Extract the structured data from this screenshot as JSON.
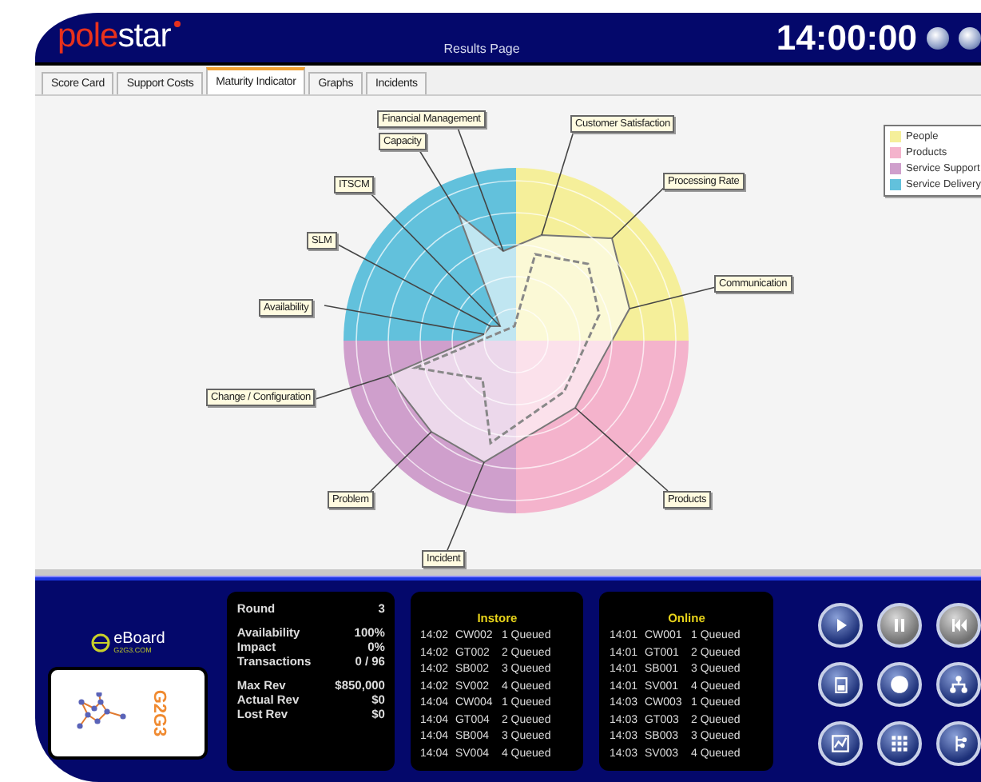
{
  "header": {
    "logo_left": "pole",
    "logo_right": "star",
    "title": "Results Page",
    "clock": "14:00:00"
  },
  "tabs": [
    {
      "label": "Score Card",
      "selected": false
    },
    {
      "label": "Support Costs",
      "selected": false
    },
    {
      "label": "Maturity Indicator",
      "selected": true
    },
    {
      "label": "Graphs",
      "selected": false
    },
    {
      "label": "Incidents",
      "selected": false
    }
  ],
  "radar": {
    "callouts": [
      "Financial Management",
      "Customer Satisfaction",
      "Capacity",
      "ITSCM",
      "Processing Rate",
      "SLM",
      "Communication",
      "Availability",
      "Change / Configuration",
      "Problem",
      "Products",
      "Incident"
    ],
    "legend": [
      {
        "label": "People",
        "color": "#f5ef9a"
      },
      {
        "label": "Products",
        "color": "#f4b3cc"
      },
      {
        "label": "Service Support",
        "color": "#cf9fcc"
      },
      {
        "label": "Service Delivery",
        "color": "#62c1dc"
      }
    ]
  },
  "brand": {
    "name": "eBoard",
    "site": "G2G3.COM",
    "badge": "G2G3"
  },
  "stats": [
    [
      {
        "label": "Round",
        "value": "3"
      }
    ],
    [
      {
        "label": "Availability",
        "value": "100%"
      },
      {
        "label": "Impact",
        "value": "0%"
      },
      {
        "label": "Transactions",
        "value": "0 / 96"
      }
    ],
    [
      {
        "label": "Max Rev",
        "value": "$850,000"
      },
      {
        "label": "Actual Rev",
        "value": "$0"
      },
      {
        "label": "Lost Rev",
        "value": "$0"
      }
    ]
  ],
  "queues": [
    {
      "title": "Instore",
      "rows": [
        [
          "14:02",
          "CW002",
          "1 Queued"
        ],
        [
          "14:02",
          "GT002",
          "2 Queued"
        ],
        [
          "14:02",
          "SB002",
          "3 Queued"
        ],
        [
          "14:02",
          "SV002",
          "4 Queued"
        ],
        [
          "14:04",
          "CW004",
          "1 Queued"
        ],
        [
          "14:04",
          "GT004",
          "2 Queued"
        ],
        [
          "14:04",
          "SB004",
          "3 Queued"
        ],
        [
          "14:04",
          "SV004",
          "4 Queued"
        ]
      ]
    },
    {
      "title": "Online",
      "rows": [
        [
          "14:01",
          "CW001",
          "1 Queued"
        ],
        [
          "14:01",
          "GT001",
          "2 Queued"
        ],
        [
          "14:01",
          "SB001",
          "3 Queued"
        ],
        [
          "14:01",
          "SV001",
          "4 Queued"
        ],
        [
          "14:03",
          "CW003",
          "1 Queued"
        ],
        [
          "14:03",
          "GT003",
          "2 Queued"
        ],
        [
          "14:03",
          "SB003",
          "3 Queued"
        ],
        [
          "14:03",
          "SV003",
          "4 Queued"
        ]
      ]
    }
  ],
  "controls": [
    {
      "kind": "play",
      "disabled": false
    },
    {
      "kind": "pause",
      "disabled": true
    },
    {
      "kind": "rewind",
      "disabled": true
    },
    {
      "kind": "save",
      "disabled": false
    },
    {
      "kind": "stop",
      "disabled": false
    },
    {
      "kind": "network",
      "disabled": false
    },
    {
      "kind": "chart",
      "disabled": false
    },
    {
      "kind": "grid",
      "disabled": false
    },
    {
      "kind": "tree",
      "disabled": false
    }
  ]
}
